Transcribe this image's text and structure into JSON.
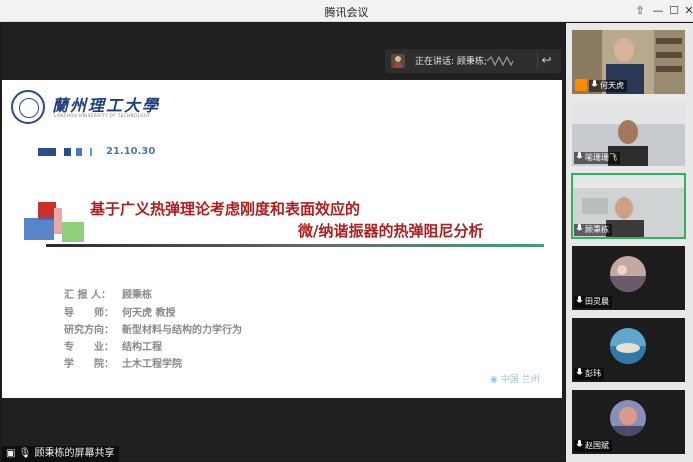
{
  "window": {
    "title": "腾讯会议"
  },
  "controls": {
    "pin": "⇧",
    "minimize": "—",
    "maximize": "☐",
    "close": "✕"
  },
  "speaking": {
    "text": "正在讲话: 顾秉栋;"
  },
  "slide": {
    "university_cn": "蘭州理工大學",
    "university_en": "LANZHOU UNIVERSITY OF TECHNOLOGY",
    "date": "21.10.30",
    "title_line1": "基于广义热弹理论考虑刚度和表面效应的",
    "title_line2": "微/纳谐振器的热弹阻尼分析",
    "info": [
      {
        "label": "汇 报 人：",
        "value": "顾秉栋"
      },
      {
        "label": "导　　师：",
        "value": "何天虎 教授"
      },
      {
        "label": "研究方向：",
        "value": "新型材料与结构的力学行为"
      },
      {
        "label": "专　　业：",
        "value": "结构工程"
      },
      {
        "label": "学　　院：",
        "value": "土木工程学院"
      }
    ],
    "location": "中国·兰州",
    "accent_red": "#b01e1e",
    "accent_blue": "#4a78b8"
  },
  "share_label": "顾秉栋的屏幕共享",
  "participants": [
    {
      "name": "何天虎"
    },
    {
      "name": "喻珊珊飞"
    },
    {
      "name": "顾秉栋"
    },
    {
      "name": "田灵晨"
    },
    {
      "name": "彭玮"
    },
    {
      "name": "赵国斌"
    }
  ]
}
